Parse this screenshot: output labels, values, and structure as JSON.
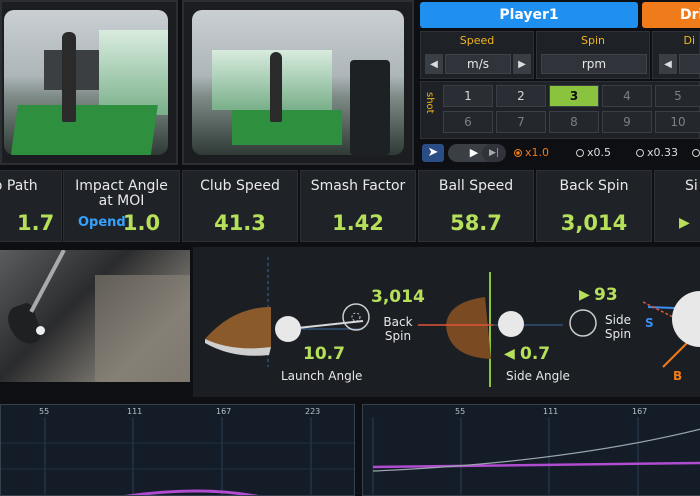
{
  "player": {
    "name": "Player1",
    "mode_tab": "Drive"
  },
  "controls": {
    "speed": {
      "label": "Speed",
      "unit": "m/s"
    },
    "spin": {
      "label": "Spin",
      "unit": "rpm"
    },
    "dist": {
      "label": "Di"
    },
    "shot_label": "shot",
    "shots": [
      {
        "n": "1",
        "state": "normal"
      },
      {
        "n": "2",
        "state": "normal"
      },
      {
        "n": "3",
        "state": "active"
      },
      {
        "n": "4",
        "state": "dim"
      },
      {
        "n": "5",
        "state": "dim"
      },
      {
        "n": "6",
        "state": "dim"
      },
      {
        "n": "7",
        "state": "dim"
      },
      {
        "n": "8",
        "state": "dim"
      },
      {
        "n": "9",
        "state": "dim"
      },
      {
        "n": "10",
        "state": "dim"
      }
    ],
    "speeds": [
      "x1.0",
      "x0.5",
      "x0.33"
    ]
  },
  "metrics": [
    {
      "label": "Club Path",
      "value": "1.7"
    },
    {
      "label": "Impact Angle at MOI",
      "value": "1.0",
      "note": "Opend"
    },
    {
      "label": "Club Speed",
      "value": "41.3"
    },
    {
      "label": "Smash Factor",
      "value": "1.42"
    },
    {
      "label": "Ball Speed",
      "value": "58.7"
    },
    {
      "label": "Back Spin",
      "value": "3,014"
    },
    {
      "label": "Si"
    }
  ],
  "viz": {
    "back_spin_value": "3,014",
    "back_spin_label": "Back Spin",
    "launch_angle_value": "10.7",
    "launch_angle_label": "Launch Angle",
    "side_spin_value": "93",
    "side_spin_label": "Side Spin",
    "side_angle_value": "0.7",
    "side_angle_label": "Side Angle",
    "ball_letters": [
      "S",
      "B"
    ]
  },
  "charts": [
    {
      "ticks": [
        "55",
        "111",
        "167",
        "223"
      ]
    },
    {
      "ticks": [
        "55",
        "111",
        "167"
      ]
    }
  ],
  "colors": {
    "accent_green": "#b6e05a",
    "player_blue": "#1f8ff0",
    "drive_orange": "#f07b1a",
    "label_yellow": "#f2b51c"
  }
}
